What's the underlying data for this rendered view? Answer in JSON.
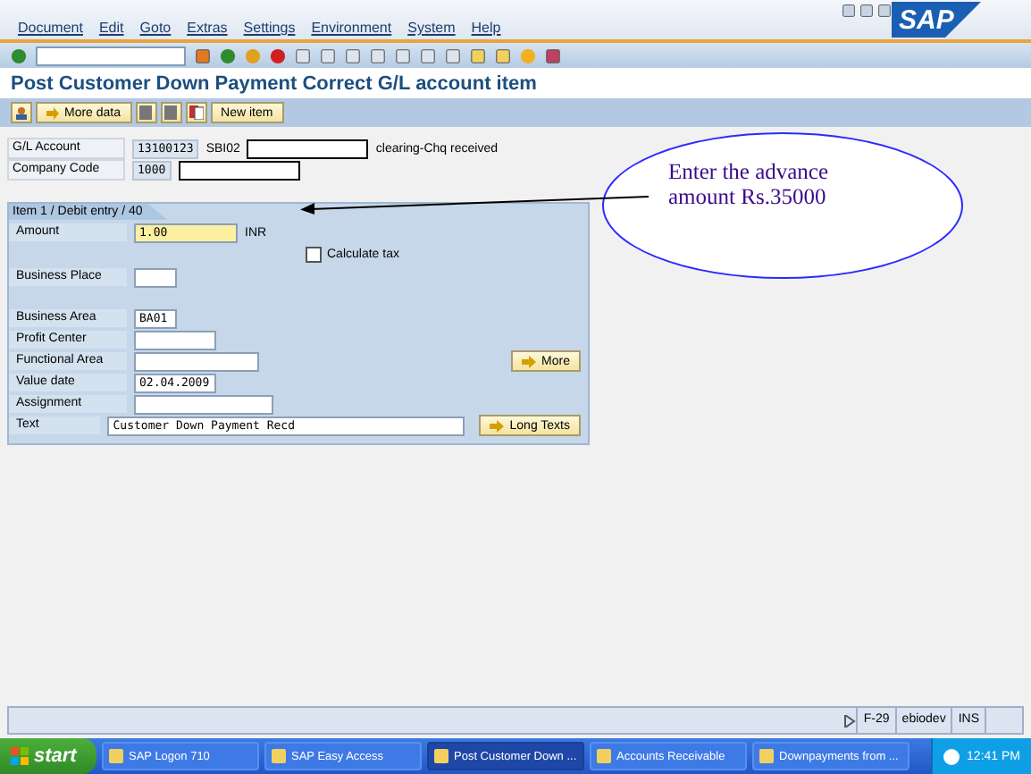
{
  "menu": [
    "Document",
    "Edit",
    "Goto",
    "Extras",
    "Settings",
    "Environment",
    "System",
    "Help"
  ],
  "logo": "SAP",
  "title": "Post Customer Down Payment Correct G/L account item",
  "app_toolbar": {
    "more_data": "More data",
    "new_item": "New item"
  },
  "header": [
    {
      "label": "G/L Account",
      "value": "13100123",
      "code": "SBI02",
      "description": "clearing-Chq received"
    },
    {
      "label": "Company Code",
      "value": "1000"
    }
  ],
  "item": {
    "tab": "Item 1 / Debit entry / 40",
    "fields": [
      {
        "label": "Amount",
        "value": "1.00",
        "unit": "INR",
        "highlighted": true
      },
      {
        "label": "Business Place"
      },
      {
        "label": "Business Area",
        "value": "BA01"
      },
      {
        "label": "Profit Center"
      },
      {
        "label": "Functional Area",
        "button": "More"
      },
      {
        "label": "Value date",
        "value": "02.04.2009"
      },
      {
        "label": "Assignment"
      },
      {
        "label": "Text",
        "value": "Customer Down Payment Recd",
        "button": "Long Texts"
      }
    ],
    "checkbox": {
      "label": "Calculate tax",
      "checked": false
    }
  },
  "callout": "Enter the advance amount Rs.35000",
  "status": {
    "transaction": "F-29",
    "server": "ebiodev",
    "mode": "INS"
  },
  "taskbar": {
    "start": "start",
    "clock": "12:41 PM",
    "tasks": [
      {
        "label": "SAP Logon 710",
        "selected": false
      },
      {
        "label": "SAP Easy Access",
        "selected": false
      },
      {
        "label": "Post Customer Down ...",
        "selected": true
      },
      {
        "label": "Accounts Receivable",
        "selected": false
      },
      {
        "label": "Downpayments from ...",
        "selected": false
      }
    ]
  }
}
